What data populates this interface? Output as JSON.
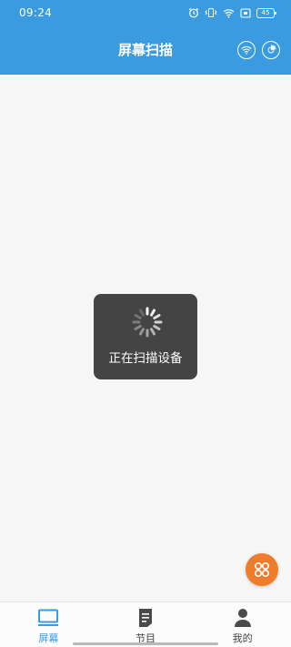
{
  "status_bar": {
    "time": "09:24",
    "icons": [
      "alarm-icon",
      "vibrate-icon",
      "wifi-icon",
      "notification-icon",
      "battery-icon"
    ],
    "battery": "45"
  },
  "app_bar": {
    "title": "屏幕扫描",
    "actions": [
      "wifi-scan-icon",
      "radar-icon"
    ]
  },
  "toast": {
    "icon": "spinner-icon",
    "message": "正在扫描设备"
  },
  "fab": {
    "icon": "apps-grid-icon"
  },
  "bottom_nav": {
    "items": [
      {
        "label": "屏幕",
        "icon": "monitor-icon",
        "active": true
      },
      {
        "label": "节目",
        "icon": "document-icon",
        "active": false
      },
      {
        "label": "我的",
        "icon": "person-icon",
        "active": false
      }
    ]
  },
  "colors": {
    "header": "#3a9be0",
    "accent": "#3a9be0",
    "fab": "#f07b2a",
    "background": "#f6f6f6"
  }
}
